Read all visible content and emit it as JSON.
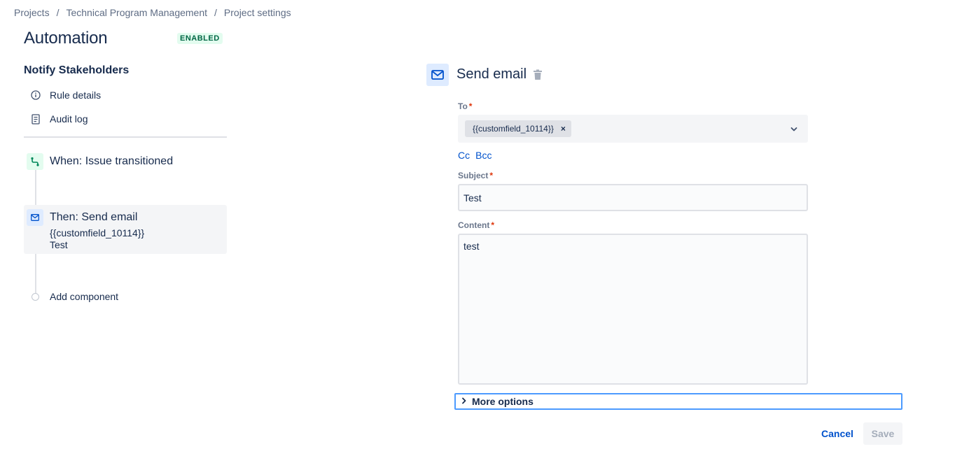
{
  "breadcrumb": {
    "items": [
      "Projects",
      "Technical Program Management",
      "Project settings"
    ],
    "separator": "/"
  },
  "header": {
    "title": "Automation",
    "status": "ENABLED"
  },
  "sidebar": {
    "rule_name": "Notify Stakeholders",
    "links": [
      {
        "label": "Rule details",
        "icon": "info-icon"
      },
      {
        "label": "Audit log",
        "icon": "document-icon"
      }
    ],
    "trigger": {
      "label": "When: Issue transitioned",
      "icon": "transition-icon"
    },
    "action": {
      "title": "Then: Send email",
      "line1": "{{customfield_10114}}",
      "line2": "Test",
      "icon": "email-icon"
    },
    "add_component": "Add component"
  },
  "panel": {
    "title": "Send email",
    "to": {
      "label": "To",
      "required_mark": "*",
      "tag": "{{customfield_10114}}",
      "remove": "×"
    },
    "cc_label": "Cc",
    "bcc_label": "Bcc",
    "subject": {
      "label": "Subject",
      "required_mark": "*",
      "value": "Test"
    },
    "content": {
      "label": "Content",
      "required_mark": "*",
      "value": "test"
    },
    "more_options": "More options",
    "cancel": "Cancel",
    "save": "Save"
  },
  "colors": {
    "link": "#0052cc",
    "enabled_bg": "#e3fcef",
    "enabled_text": "#006644",
    "focus": "#4c9aff"
  }
}
